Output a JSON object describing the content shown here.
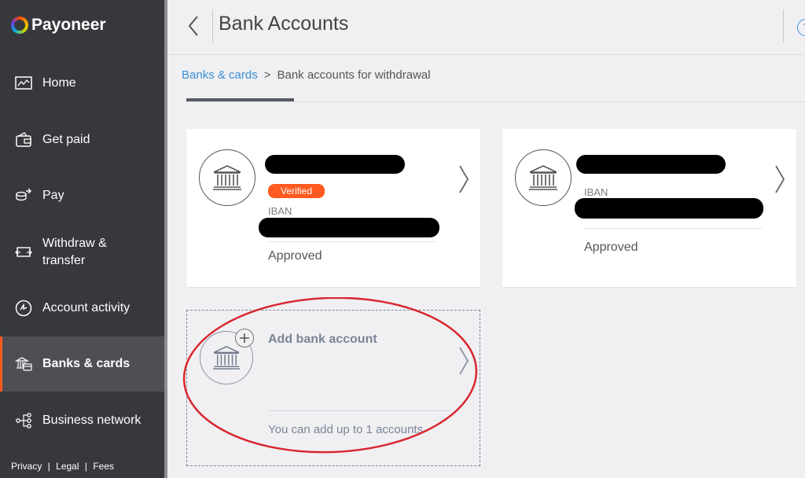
{
  "app": {
    "brand": "Payoneer"
  },
  "sidebar": {
    "items": [
      {
        "label": "Home",
        "icon": "chart-monitor-icon"
      },
      {
        "label": "Get paid",
        "icon": "wallet-icon"
      },
      {
        "label": "Pay",
        "icon": "coins-arrow-icon"
      },
      {
        "label": "Withdraw &\ntransfer",
        "icon": "transfer-icon"
      },
      {
        "label": "Account activity",
        "icon": "activity-icon"
      },
      {
        "label": "Banks & cards",
        "icon": "bank-card-icon",
        "active": true
      },
      {
        "label": "Business network",
        "icon": "network-icon"
      }
    ],
    "footer": {
      "privacy": "Privacy",
      "legal": "Legal",
      "fees": "Fees",
      "separator": "|"
    }
  },
  "header": {
    "title": "Bank Accounts",
    "help": "?"
  },
  "breadcrumb": {
    "parent": "Banks & cards",
    "separator": ">",
    "current": "Bank accounts for withdrawal"
  },
  "accounts": [
    {
      "badge": "Verified",
      "iban_label": "IBAN",
      "status": "Approved"
    },
    {
      "iban_label": "IBAN",
      "status": "Approved"
    }
  ],
  "add_account": {
    "title": "Add bank account",
    "note": "You can add up to 1 accounts"
  },
  "colors": {
    "sidebar_bg": "#37383c",
    "accent": "#ff5a1f",
    "link": "#3c8fd3",
    "annotation": "#d9272e"
  }
}
